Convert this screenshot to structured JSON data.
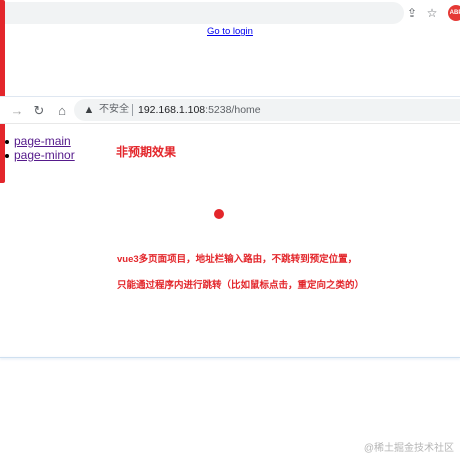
{
  "browser_top": {
    "icons": [
      "share-icon",
      "star-icon",
      "adblock-icon"
    ],
    "adblock_label": "ABP"
  },
  "go_to_login": "Go to login",
  "browser": {
    "security_label": "不安全",
    "url_host": "192.168.1.108",
    "url_rest": ":5238/home",
    "icons": [
      "forward-icon",
      "reload-icon",
      "home-icon",
      "warning-icon"
    ]
  },
  "page_links": [
    "page-main",
    "page-minor"
  ],
  "annotations": {
    "title": "非预期效果",
    "line1": "vue3多页面项目，地址栏输入路由，不跳转到预定位置，",
    "line2": "只能通过程序内进行跳转（比如鼠标点击，重定向之类的）"
  },
  "watermark": "@稀土掘金技术社区",
  "colors": {
    "annotation_red": "#e3262b",
    "link_visited": "#551a8b",
    "link_blue": "#0000ee"
  }
}
